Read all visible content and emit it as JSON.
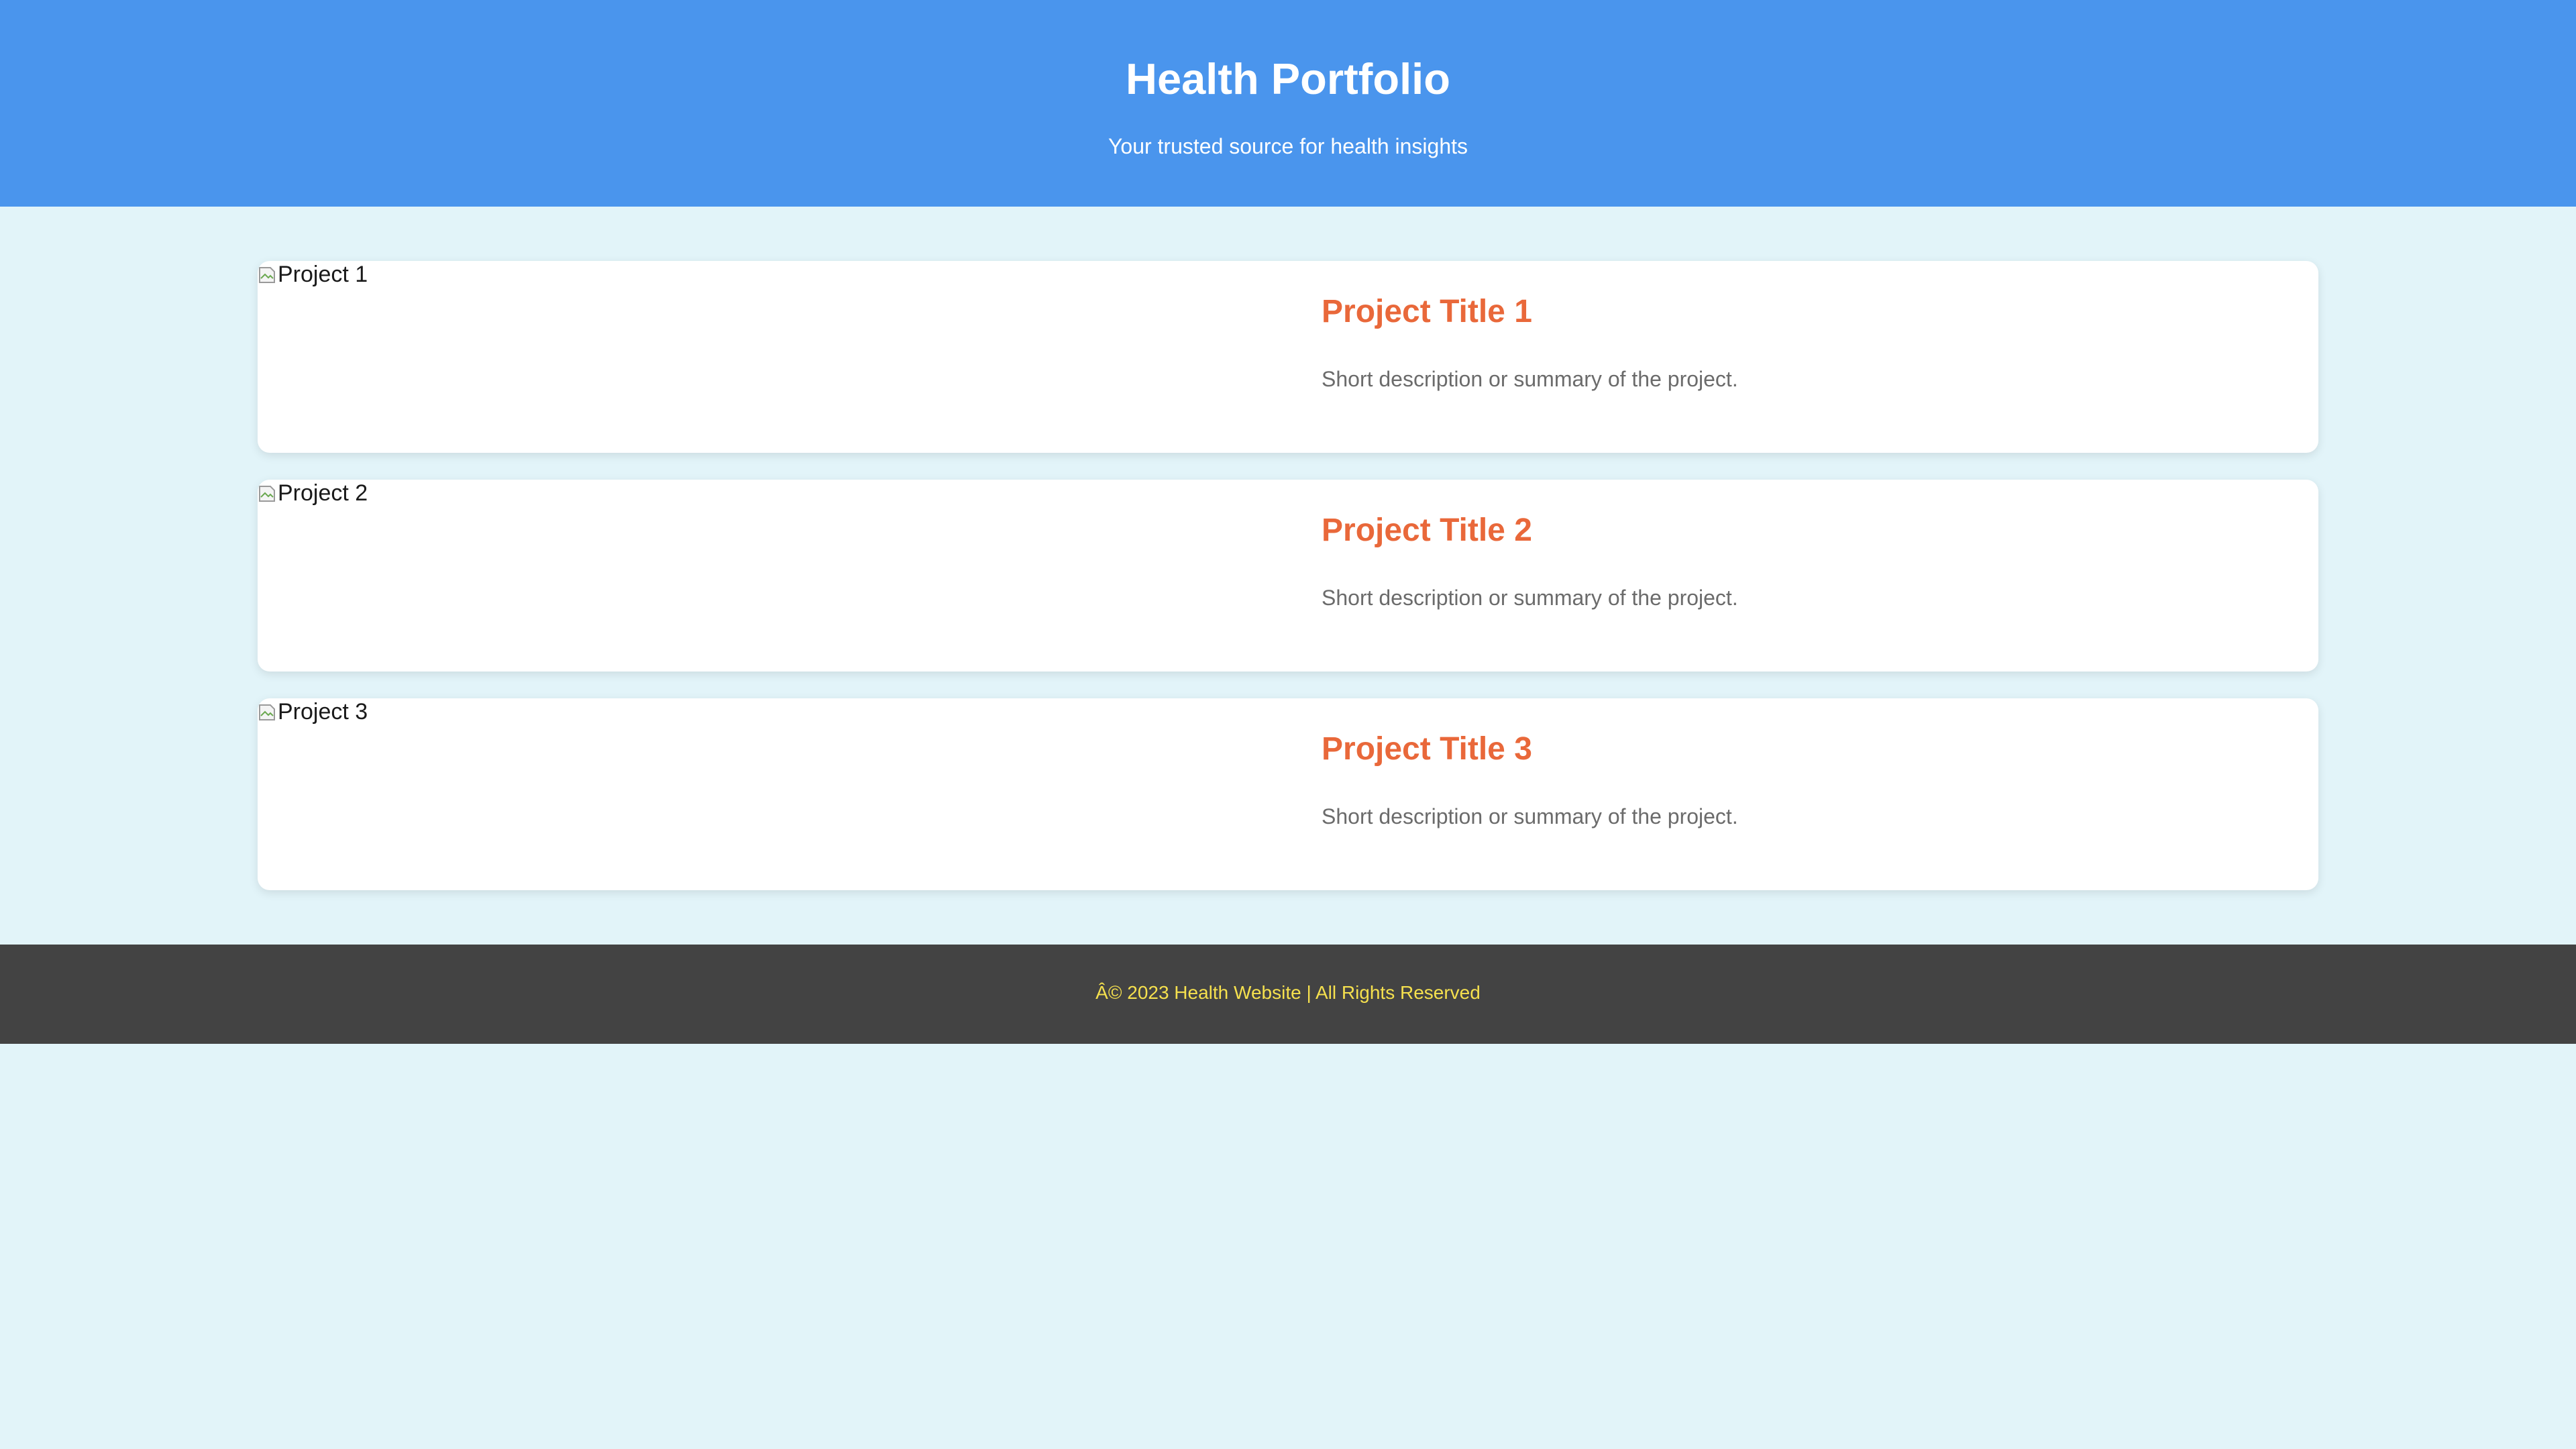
{
  "header": {
    "title": "Health Portfolio",
    "subtitle": "Your trusted source for health insights"
  },
  "projects": [
    {
      "image_alt": "Project 1",
      "title": "Project Title 1",
      "description": "Short description or summary of the project."
    },
    {
      "image_alt": "Project 2",
      "title": "Project Title 2",
      "description": "Short description or summary of the project."
    },
    {
      "image_alt": "Project 3",
      "title": "Project Title 3",
      "description": "Short description or summary of the project."
    }
  ],
  "footer": {
    "text": "Â© 2023 Health Website | All Rights Reserved"
  },
  "colors": {
    "header_bg": "#4a95ed",
    "page_bg": "#e2f4f9",
    "project_title": "#e9683a",
    "footer_bg": "#434343",
    "footer_text": "#f5e04e"
  }
}
